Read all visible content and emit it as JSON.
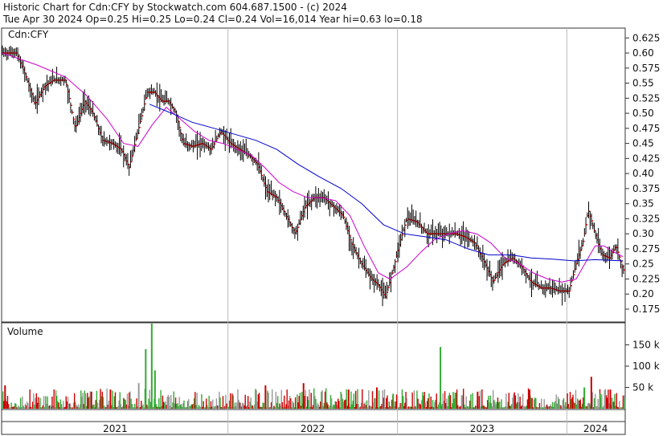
{
  "header": {
    "line1": "Historic Chart for Cdn:CFY by Stockwatch.com 604.687.1500 - (c) 2024",
    "line2": "Tue Apr 30 2024  Op=0.25  Hi=0.25  Lo=0.24  Cl=0.24  Vol=16,014  Year hi=0.63  lo=0.18"
  },
  "chart_data": {
    "type": "line",
    "symbol_label": "Cdn:CFY",
    "volume_label": "Volume",
    "price_axis": {
      "ticks": [
        0.175,
        0.2,
        0.225,
        0.25,
        0.275,
        0.3,
        0.325,
        0.35,
        0.375,
        0.4,
        0.425,
        0.45,
        0.475,
        0.5,
        0.525,
        0.55,
        0.575,
        0.6,
        0.625
      ],
      "tick_labels": [
        "0.175",
        "0.20",
        "0.225",
        "0.25",
        "0.275",
        "0.30",
        "0.325",
        "0.35",
        "0.375",
        "0.40",
        "0.425",
        "0.45",
        "0.475",
        "0.50",
        "0.525",
        "0.55",
        "0.575",
        "0.60",
        "0.625"
      ],
      "range": [
        0.155,
        0.64
      ]
    },
    "volume_axis": {
      "ticks": [
        50000,
        100000,
        150000
      ],
      "tick_labels": [
        "50 k",
        "100 k",
        "150 k"
      ],
      "range": [
        0,
        200000
      ]
    },
    "x_axis": {
      "years": [
        "2021",
        "2022",
        "2023",
        "2024"
      ],
      "year_boundaries": [
        "2021-12-31",
        "2022-12-31",
        "2023-12-31"
      ],
      "start": "2020-09-01",
      "end": "2024-05-03"
    },
    "series": [
      {
        "kind": "close",
        "color": "#cc0000",
        "points": [
          [
            "2020-09-01",
            0.6
          ],
          [
            "2020-10-01",
            0.6
          ],
          [
            "2020-10-20",
            0.565
          ],
          [
            "2020-11-10",
            0.515
          ],
          [
            "2020-12-01",
            0.545
          ],
          [
            "2020-12-20",
            0.555
          ],
          [
            "2021-01-15",
            0.555
          ],
          [
            "2021-02-05",
            0.475
          ],
          [
            "2021-02-25",
            0.52
          ],
          [
            "2021-03-15",
            0.5
          ],
          [
            "2021-04-05",
            0.455
          ],
          [
            "2021-04-25",
            0.45
          ],
          [
            "2021-05-15",
            0.44
          ],
          [
            "2021-06-01",
            0.41
          ],
          [
            "2021-06-20",
            0.47
          ],
          [
            "2021-07-10",
            0.535
          ],
          [
            "2021-07-25",
            0.535
          ],
          [
            "2021-08-10",
            0.52
          ],
          [
            "2021-08-25",
            0.52
          ],
          [
            "2021-09-10",
            0.5
          ],
          [
            "2021-09-25",
            0.45
          ],
          [
            "2021-10-15",
            0.445
          ],
          [
            "2021-11-05",
            0.45
          ],
          [
            "2021-11-25",
            0.44
          ],
          [
            "2021-12-15",
            0.47
          ],
          [
            "2022-01-05",
            0.45
          ],
          [
            "2022-01-25",
            0.44
          ],
          [
            "2022-02-15",
            0.43
          ],
          [
            "2022-03-05",
            0.415
          ],
          [
            "2022-03-25",
            0.37
          ],
          [
            "2022-04-15",
            0.36
          ],
          [
            "2022-05-05",
            0.33
          ],
          [
            "2022-05-25",
            0.3
          ],
          [
            "2022-06-15",
            0.345
          ],
          [
            "2022-07-05",
            0.36
          ],
          [
            "2022-07-25",
            0.36
          ],
          [
            "2022-08-15",
            0.345
          ],
          [
            "2022-09-05",
            0.33
          ],
          [
            "2022-09-25",
            0.28
          ],
          [
            "2022-10-15",
            0.25
          ],
          [
            "2022-11-05",
            0.225
          ],
          [
            "2022-11-20",
            0.215
          ],
          [
            "2022-12-05",
            0.195
          ],
          [
            "2022-12-20",
            0.235
          ],
          [
            "2023-01-05",
            0.285
          ],
          [
            "2023-01-20",
            0.325
          ],
          [
            "2023-02-10",
            0.32
          ],
          [
            "2023-03-05",
            0.3
          ],
          [
            "2023-03-25",
            0.3
          ],
          [
            "2023-04-15",
            0.3
          ],
          [
            "2023-05-05",
            0.3
          ],
          [
            "2023-05-25",
            0.295
          ],
          [
            "2023-06-15",
            0.285
          ],
          [
            "2023-07-05",
            0.255
          ],
          [
            "2023-07-25",
            0.22
          ],
          [
            "2023-08-15",
            0.25
          ],
          [
            "2023-09-05",
            0.26
          ],
          [
            "2023-09-25",
            0.245
          ],
          [
            "2023-10-15",
            0.22
          ],
          [
            "2023-11-05",
            0.21
          ],
          [
            "2023-11-25",
            0.21
          ],
          [
            "2023-12-15",
            0.205
          ],
          [
            "2024-01-05",
            0.205
          ],
          [
            "2024-01-20",
            0.25
          ],
          [
            "2024-02-05",
            0.29
          ],
          [
            "2024-02-15",
            0.34
          ],
          [
            "2024-03-01",
            0.3
          ],
          [
            "2024-03-15",
            0.265
          ],
          [
            "2024-04-01",
            0.26
          ],
          [
            "2024-04-15",
            0.28
          ],
          [
            "2024-04-30",
            0.24
          ]
        ]
      },
      {
        "kind": "moving-average-short",
        "color": "#cc00cc",
        "points": [
          [
            "2020-09-01",
            0.6
          ],
          [
            "2020-11-15",
            0.58
          ],
          [
            "2021-01-15",
            0.56
          ],
          [
            "2021-03-01",
            0.53
          ],
          [
            "2021-04-15",
            0.49
          ],
          [
            "2021-05-20",
            0.45
          ],
          [
            "2021-06-20",
            0.445
          ],
          [
            "2021-07-20",
            0.48
          ],
          [
            "2021-08-20",
            0.51
          ],
          [
            "2021-09-20",
            0.49
          ],
          [
            "2021-10-20",
            0.47
          ],
          [
            "2021-11-20",
            0.455
          ],
          [
            "2021-12-20",
            0.45
          ],
          [
            "2022-01-20",
            0.44
          ],
          [
            "2022-02-20",
            0.43
          ],
          [
            "2022-03-20",
            0.41
          ],
          [
            "2022-04-20",
            0.385
          ],
          [
            "2022-05-20",
            0.37
          ],
          [
            "2022-06-20",
            0.36
          ],
          [
            "2022-07-20",
            0.36
          ],
          [
            "2022-08-20",
            0.355
          ],
          [
            "2022-09-20",
            0.33
          ],
          [
            "2022-10-20",
            0.28
          ],
          [
            "2022-11-20",
            0.235
          ],
          [
            "2022-12-15",
            0.225
          ],
          [
            "2023-01-20",
            0.245
          ],
          [
            "2023-02-20",
            0.27
          ],
          [
            "2023-03-20",
            0.29
          ],
          [
            "2023-04-20",
            0.3
          ],
          [
            "2023-05-20",
            0.305
          ],
          [
            "2023-06-20",
            0.3
          ],
          [
            "2023-07-20",
            0.285
          ],
          [
            "2023-08-20",
            0.26
          ],
          [
            "2023-09-20",
            0.25
          ],
          [
            "2023-10-20",
            0.235
          ],
          [
            "2023-11-20",
            0.225
          ],
          [
            "2023-12-20",
            0.22
          ],
          [
            "2024-01-20",
            0.225
          ],
          [
            "2024-02-15",
            0.26
          ],
          [
            "2024-03-01",
            0.28
          ],
          [
            "2024-03-20",
            0.28
          ],
          [
            "2024-04-10",
            0.27
          ],
          [
            "2024-04-30",
            0.262
          ]
        ]
      },
      {
        "kind": "moving-average-long",
        "color": "#0000cc",
        "points": [
          [
            "2021-07-15",
            0.515
          ],
          [
            "2021-09-01",
            0.5
          ],
          [
            "2021-10-15",
            0.485
          ],
          [
            "2021-12-01",
            0.475
          ],
          [
            "2022-01-15",
            0.465
          ],
          [
            "2022-03-01",
            0.455
          ],
          [
            "2022-04-15",
            0.44
          ],
          [
            "2022-06-01",
            0.415
          ],
          [
            "2022-07-15",
            0.395
          ],
          [
            "2022-09-01",
            0.375
          ],
          [
            "2022-10-15",
            0.35
          ],
          [
            "2022-12-01",
            0.315
          ],
          [
            "2023-01-15",
            0.3
          ],
          [
            "2023-03-01",
            0.295
          ],
          [
            "2023-04-15",
            0.29
          ],
          [
            "2023-06-01",
            0.275
          ],
          [
            "2023-07-15",
            0.265
          ],
          [
            "2023-09-01",
            0.265
          ],
          [
            "2023-10-15",
            0.26
          ],
          [
            "2023-12-01",
            0.258
          ],
          [
            "2024-01-15",
            0.255
          ],
          [
            "2024-03-01",
            0.257
          ],
          [
            "2024-04-30",
            0.255
          ]
        ]
      }
    ],
    "volume": {
      "colors": {
        "up": "#33aa33",
        "down": "#cc0000",
        "flat": "#999999"
      },
      "bars": [
        [
          "2021-07-05",
          140000,
          "up"
        ],
        [
          "2021-07-18",
          200000,
          "up"
        ],
        [
          "2021-07-25",
          90000,
          "up"
        ],
        [
          "2021-06-20",
          60000,
          "flat"
        ],
        [
          "2023-04-01",
          145000,
          "up"
        ],
        [
          "2024-02-20",
          75000,
          "down"
        ],
        [
          "2024-02-05",
          50000,
          "up"
        ],
        [
          "2022-11-15",
          50000,
          "down"
        ],
        [
          "2022-06-10",
          60000,
          "down"
        ],
        [
          "2022-03-20",
          55000,
          "down"
        ],
        [
          "2022-09-15",
          45000,
          "down"
        ],
        [
          "2020-09-05",
          55000,
          "down"
        ],
        [
          "2021-04-20",
          45000,
          "down"
        ],
        [
          "2021-03-10",
          40000,
          "down"
        ],
        [
          "2023-06-20",
          40000,
          "down"
        ],
        [
          "2023-10-10",
          45000,
          "down"
        ],
        [
          "2024-04-01",
          45000,
          "down"
        ],
        [
          "2024-03-10",
          35000,
          "up"
        ],
        [
          "2022-12-20",
          35000,
          "up"
        ],
        [
          "2023-01-10",
          30000,
          "up"
        ]
      ],
      "background_seed": 7
    }
  }
}
